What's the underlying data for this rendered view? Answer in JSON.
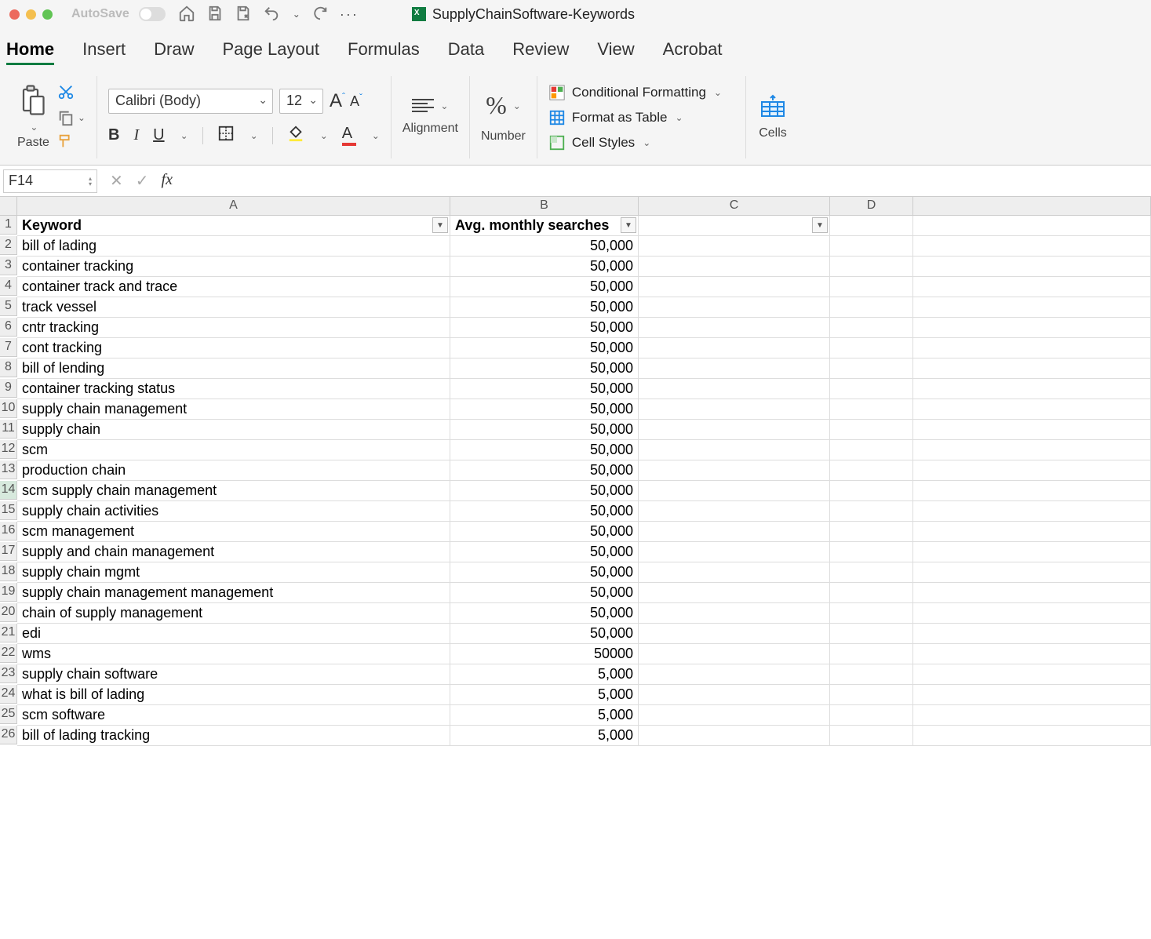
{
  "window": {
    "autosave_label": "AutoSave",
    "document_name": "SupplyChainSoftware-Keywords"
  },
  "tabs": [
    "Home",
    "Insert",
    "Draw",
    "Page Layout",
    "Formulas",
    "Data",
    "Review",
    "View",
    "Acrobat"
  ],
  "ribbon": {
    "paste_label": "Paste",
    "font_name": "Calibri (Body)",
    "font_size": "12",
    "alignment_label": "Alignment",
    "number_label": "Number",
    "cond_fmt": "Conditional Formatting",
    "fmt_table": "Format as Table",
    "cell_styles": "Cell Styles",
    "cells_label": "Cells"
  },
  "formula_bar": {
    "namebox": "F14",
    "formula": ""
  },
  "columns": [
    "A",
    "B",
    "C",
    "D"
  ],
  "headers": {
    "a": "Keyword",
    "b": "Avg. monthly searches",
    "c": ""
  },
  "rows": [
    {
      "n": "2",
      "a": "bill of lading",
      "b": "50,000"
    },
    {
      "n": "3",
      "a": "container tracking",
      "b": "50,000"
    },
    {
      "n": "4",
      "a": "container track and trace",
      "b": "50,000"
    },
    {
      "n": "5",
      "a": "track vessel",
      "b": "50,000"
    },
    {
      "n": "6",
      "a": "cntr tracking",
      "b": "50,000"
    },
    {
      "n": "7",
      "a": "cont tracking",
      "b": "50,000"
    },
    {
      "n": "8",
      "a": "bill of lending",
      "b": "50,000"
    },
    {
      "n": "9",
      "a": "container tracking status",
      "b": "50,000"
    },
    {
      "n": "10",
      "a": "supply chain management",
      "b": "50,000"
    },
    {
      "n": "11",
      "a": "supply chain",
      "b": "50,000"
    },
    {
      "n": "12",
      "a": "scm",
      "b": "50,000"
    },
    {
      "n": "13",
      "a": "production chain",
      "b": "50,000"
    },
    {
      "n": "14",
      "a": "scm supply chain management",
      "b": "50,000"
    },
    {
      "n": "15",
      "a": "supply chain activities",
      "b": "50,000"
    },
    {
      "n": "16",
      "a": "scm management",
      "b": "50,000"
    },
    {
      "n": "17",
      "a": "supply and chain management",
      "b": "50,000"
    },
    {
      "n": "18",
      "a": "supply chain mgmt",
      "b": "50,000"
    },
    {
      "n": "19",
      "a": "supply chain management management",
      "b": "50,000"
    },
    {
      "n": "20",
      "a": "chain of supply management",
      "b": "50,000"
    },
    {
      "n": "21",
      "a": "edi",
      "b": "50,000"
    },
    {
      "n": "22",
      "a": "wms",
      "b": "50000"
    },
    {
      "n": "23",
      "a": "supply chain software",
      "b": "5,000"
    },
    {
      "n": "24",
      "a": "what is bill of lading",
      "b": "5,000"
    },
    {
      "n": "25",
      "a": "scm software",
      "b": "5,000"
    },
    {
      "n": "26",
      "a": "bill of lading tracking",
      "b": "5,000"
    }
  ]
}
